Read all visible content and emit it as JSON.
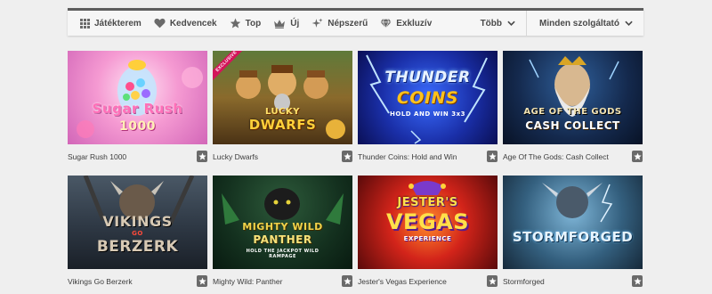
{
  "nav": {
    "items": [
      {
        "label": "Játékterem",
        "icon": "grid-icon"
      },
      {
        "label": "Kedvencek",
        "icon": "heart-icon"
      },
      {
        "label": "Top",
        "icon": "star-icon"
      },
      {
        "label": "Új",
        "icon": "crown-icon"
      },
      {
        "label": "Népszerű",
        "icon": "sparkle-icon"
      },
      {
        "label": "Exkluzív",
        "icon": "diamond-icon"
      }
    ],
    "more_label": "Több",
    "provider_label": "Minden szolgáltató"
  },
  "games": [
    {
      "name": "Sugar Rush 1000",
      "art_line1": "Sugar Rush",
      "art_line2": "1000"
    },
    {
      "name": "Lucky Dwarfs",
      "art_line1": "LUCKY",
      "art_line2": "DWARFS",
      "badge": "EXCLUSIVE"
    },
    {
      "name": "Thunder Coins: Hold and Win",
      "art_line1": "THUNDER",
      "art_line2": "COINS",
      "art_line3": "HOLD AND WIN 3x3"
    },
    {
      "name": "Age Of The Gods: Cash Collect",
      "art_line1": "AGE OF THE GODS",
      "art_line2": "CASH COLLECT"
    },
    {
      "name": "Vikings Go Berzerk",
      "art_line1": "VIKINGS",
      "art_line2": "GO",
      "art_line3": "BERZERK"
    },
    {
      "name": "Mighty Wild: Panther",
      "art_line1": "MIGHTY WILD",
      "art_line2": "PANTHER",
      "art_line3": "HOLD THE JACKPOT WILD RAMPAGE"
    },
    {
      "name": "Jester's Vegas Experience",
      "art_line1": "JESTER'S",
      "art_line2": "VEGAS",
      "art_line3": "EXPERIENCE"
    },
    {
      "name": "Stormforged",
      "art_line1": "STORMFORGED"
    }
  ],
  "colors": {
    "nav_top_border": "#5d5d5d",
    "fav_button": "#6a6a6a",
    "page_bg": "#efefef"
  }
}
